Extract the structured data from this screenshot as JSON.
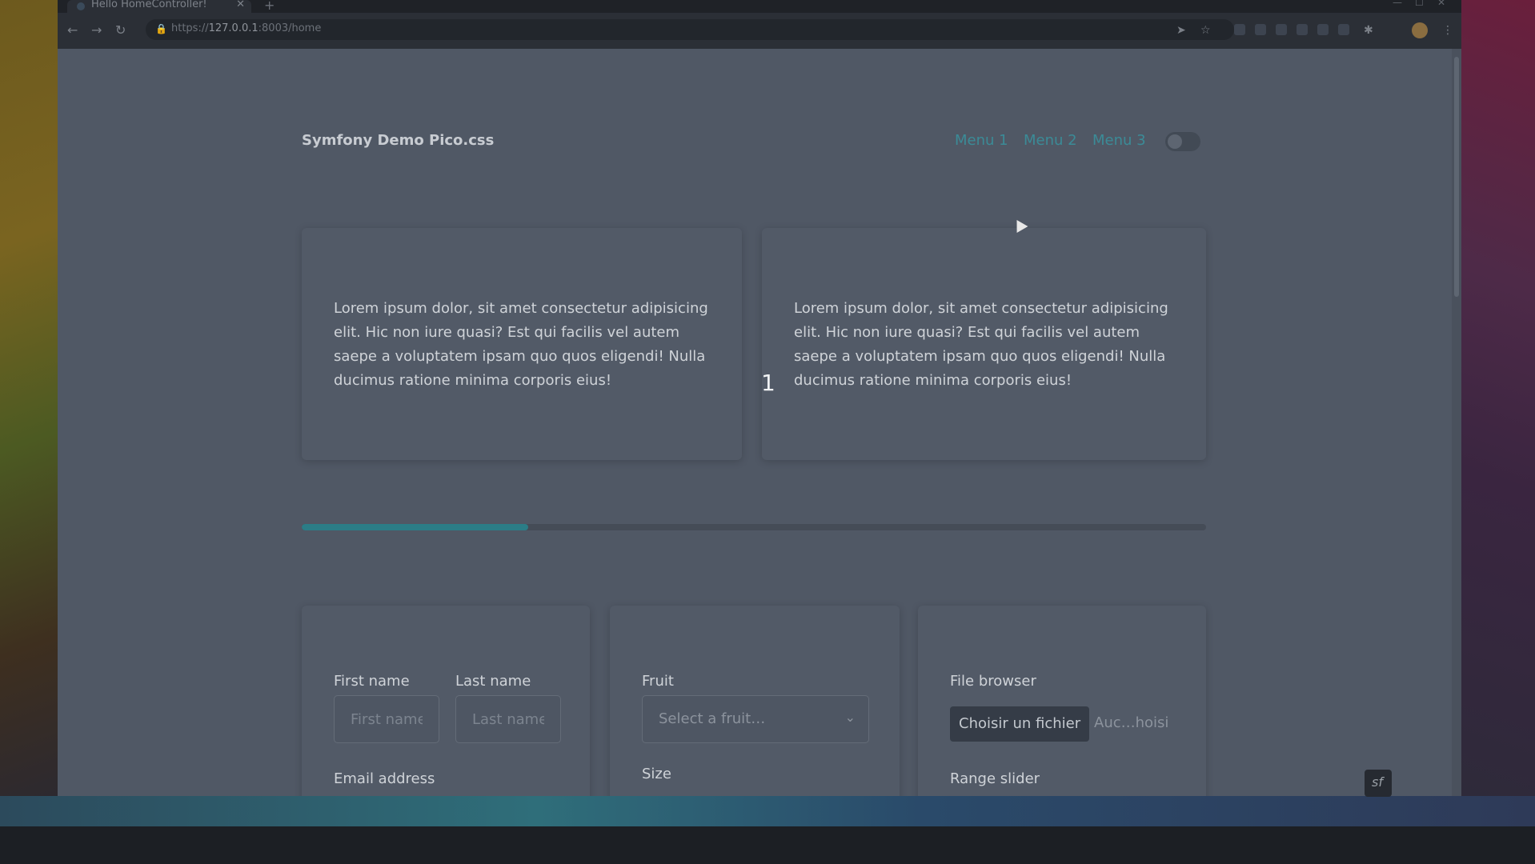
{
  "browser": {
    "tab_title": "Hello HomeController!",
    "tab_close": "✕",
    "new_tab": "+",
    "url_prefix": "https://",
    "url_host": "127.0.0.1",
    "url_rest": ":8003/home"
  },
  "nav": {
    "brand": "Symfony Demo Pico.css",
    "menu": [
      "Menu 1",
      "Menu 2",
      "Menu 3"
    ]
  },
  "carousel": {
    "cards": [
      "Lorem ipsum dolor, sit amet consectetur adipisicing elit. Hic non iure quasi? Est qui facilis vel autem saepe a voluptatem ipsam quo quos eligendi! Nulla ducimus ratione minima corporis eius!",
      "Lorem ipsum dolor, sit amet consectetur adipisicing elit. Hic non iure quasi? Est qui facilis vel autem saepe a voluptatem ipsam quo quos eligendi! Nulla ducimus ratione minima corporis eius!"
    ],
    "slide_number": "1",
    "progress_fraction": 0.25
  },
  "form": {
    "first_name_label": "First name",
    "first_name_placeholder": "First name",
    "last_name_label": "Last name",
    "last_name_placeholder": "Last name",
    "email_label": "Email address",
    "fruit_label": "Fruit",
    "fruit_selected": "Select a fruit…",
    "size_label": "Size",
    "file_label": "File browser",
    "file_button": "Choisir un fichier",
    "file_status": "Auc…hoisi",
    "range_label": "Range slider"
  },
  "colors": {
    "accent": "#3b8b97",
    "progress_fill": "#2b7d87",
    "page_bg": "#505865"
  }
}
